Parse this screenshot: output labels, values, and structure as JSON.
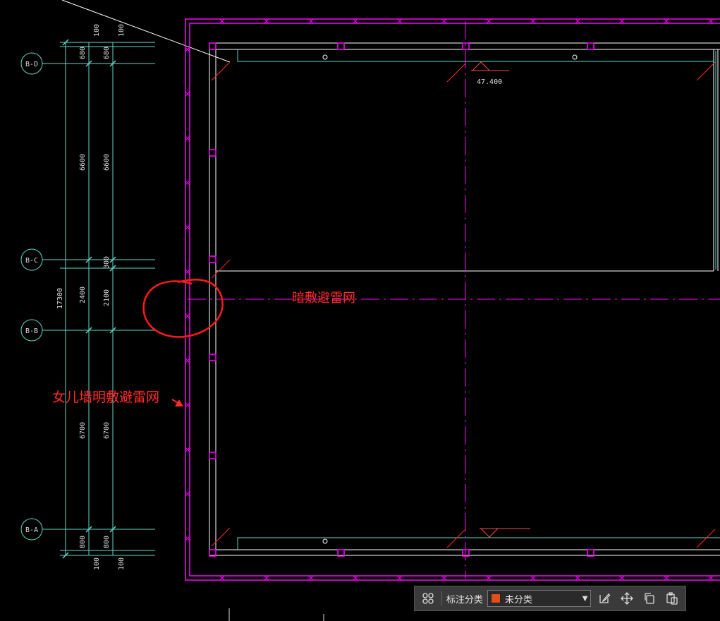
{
  "drawing": {
    "grid_labels": {
      "bd": "B-D",
      "bc": "B-C",
      "bb": "B-B",
      "ba": "B-A"
    },
    "dims_outer": {
      "top1": "100",
      "top2": "680",
      "d6600": "6600",
      "d2400": "2400",
      "d6700": "6700",
      "d800": "800",
      "bot": "100",
      "total": "17300"
    },
    "dims_inner": {
      "top1": "100",
      "top2": "680",
      "d6600": "6600",
      "d300": "300",
      "d2100": "2100",
      "d6700": "6700",
      "d800": "800",
      "bot": "100"
    },
    "elevation": "47.400",
    "annotation_hidden": "暗敷避雷网",
    "annotation_parapet": "女儿墙明敷避雷网",
    "colors": {
      "magenta": "#ff00ff",
      "cyan": "#5fd8c8",
      "white": "#ffffff",
      "red": "#ff2a2a"
    }
  },
  "toolbar": {
    "grid_icon": "grid-icon",
    "label": "标注分类",
    "select_value": "未分类",
    "swatch_color": "#e0501a",
    "edit_icon": "edit-icon",
    "move_icon": "move-icon",
    "copy_icon": "copy-icon",
    "paste_icon": "paste-icon"
  }
}
